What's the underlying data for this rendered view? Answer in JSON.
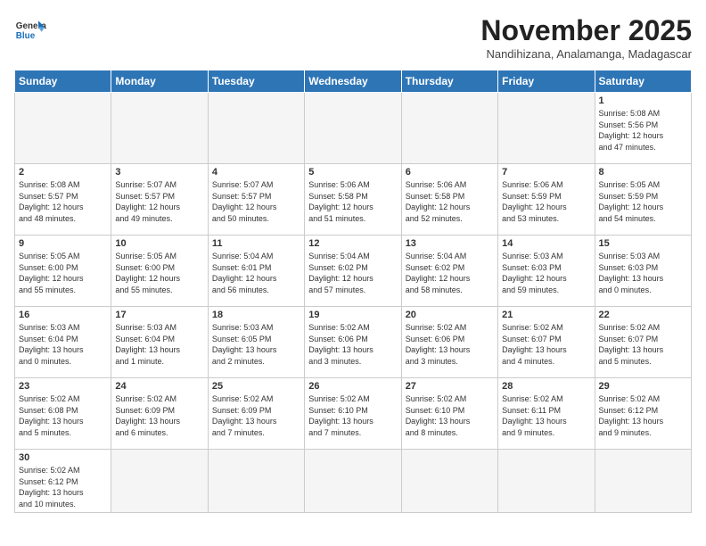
{
  "header": {
    "logo_general": "General",
    "logo_blue": "Blue",
    "month_title": "November 2025",
    "subtitle": "Nandihizana, Analamanga, Madagascar"
  },
  "weekdays": [
    "Sunday",
    "Monday",
    "Tuesday",
    "Wednesday",
    "Thursday",
    "Friday",
    "Saturday"
  ],
  "weeks": [
    [
      {
        "day": "",
        "info": ""
      },
      {
        "day": "",
        "info": ""
      },
      {
        "day": "",
        "info": ""
      },
      {
        "day": "",
        "info": ""
      },
      {
        "day": "",
        "info": ""
      },
      {
        "day": "",
        "info": ""
      },
      {
        "day": "1",
        "info": "Sunrise: 5:08 AM\nSunset: 5:56 PM\nDaylight: 12 hours\nand 47 minutes."
      }
    ],
    [
      {
        "day": "2",
        "info": "Sunrise: 5:08 AM\nSunset: 5:57 PM\nDaylight: 12 hours\nand 48 minutes."
      },
      {
        "day": "3",
        "info": "Sunrise: 5:07 AM\nSunset: 5:57 PM\nDaylight: 12 hours\nand 49 minutes."
      },
      {
        "day": "4",
        "info": "Sunrise: 5:07 AM\nSunset: 5:57 PM\nDaylight: 12 hours\nand 50 minutes."
      },
      {
        "day": "5",
        "info": "Sunrise: 5:06 AM\nSunset: 5:58 PM\nDaylight: 12 hours\nand 51 minutes."
      },
      {
        "day": "6",
        "info": "Sunrise: 5:06 AM\nSunset: 5:58 PM\nDaylight: 12 hours\nand 52 minutes."
      },
      {
        "day": "7",
        "info": "Sunrise: 5:06 AM\nSunset: 5:59 PM\nDaylight: 12 hours\nand 53 minutes."
      },
      {
        "day": "8",
        "info": "Sunrise: 5:05 AM\nSunset: 5:59 PM\nDaylight: 12 hours\nand 54 minutes."
      }
    ],
    [
      {
        "day": "9",
        "info": "Sunrise: 5:05 AM\nSunset: 6:00 PM\nDaylight: 12 hours\nand 55 minutes."
      },
      {
        "day": "10",
        "info": "Sunrise: 5:05 AM\nSunset: 6:00 PM\nDaylight: 12 hours\nand 55 minutes."
      },
      {
        "day": "11",
        "info": "Sunrise: 5:04 AM\nSunset: 6:01 PM\nDaylight: 12 hours\nand 56 minutes."
      },
      {
        "day": "12",
        "info": "Sunrise: 5:04 AM\nSunset: 6:02 PM\nDaylight: 12 hours\nand 57 minutes."
      },
      {
        "day": "13",
        "info": "Sunrise: 5:04 AM\nSunset: 6:02 PM\nDaylight: 12 hours\nand 58 minutes."
      },
      {
        "day": "14",
        "info": "Sunrise: 5:03 AM\nSunset: 6:03 PM\nDaylight: 12 hours\nand 59 minutes."
      },
      {
        "day": "15",
        "info": "Sunrise: 5:03 AM\nSunset: 6:03 PM\nDaylight: 13 hours\nand 0 minutes."
      }
    ],
    [
      {
        "day": "16",
        "info": "Sunrise: 5:03 AM\nSunset: 6:04 PM\nDaylight: 13 hours\nand 0 minutes."
      },
      {
        "day": "17",
        "info": "Sunrise: 5:03 AM\nSunset: 6:04 PM\nDaylight: 13 hours\nand 1 minute."
      },
      {
        "day": "18",
        "info": "Sunrise: 5:03 AM\nSunset: 6:05 PM\nDaylight: 13 hours\nand 2 minutes."
      },
      {
        "day": "19",
        "info": "Sunrise: 5:02 AM\nSunset: 6:06 PM\nDaylight: 13 hours\nand 3 minutes."
      },
      {
        "day": "20",
        "info": "Sunrise: 5:02 AM\nSunset: 6:06 PM\nDaylight: 13 hours\nand 3 minutes."
      },
      {
        "day": "21",
        "info": "Sunrise: 5:02 AM\nSunset: 6:07 PM\nDaylight: 13 hours\nand 4 minutes."
      },
      {
        "day": "22",
        "info": "Sunrise: 5:02 AM\nSunset: 6:07 PM\nDaylight: 13 hours\nand 5 minutes."
      }
    ],
    [
      {
        "day": "23",
        "info": "Sunrise: 5:02 AM\nSunset: 6:08 PM\nDaylight: 13 hours\nand 5 minutes."
      },
      {
        "day": "24",
        "info": "Sunrise: 5:02 AM\nSunset: 6:09 PM\nDaylight: 13 hours\nand 6 minutes."
      },
      {
        "day": "25",
        "info": "Sunrise: 5:02 AM\nSunset: 6:09 PM\nDaylight: 13 hours\nand 7 minutes."
      },
      {
        "day": "26",
        "info": "Sunrise: 5:02 AM\nSunset: 6:10 PM\nDaylight: 13 hours\nand 7 minutes."
      },
      {
        "day": "27",
        "info": "Sunrise: 5:02 AM\nSunset: 6:10 PM\nDaylight: 13 hours\nand 8 minutes."
      },
      {
        "day": "28",
        "info": "Sunrise: 5:02 AM\nSunset: 6:11 PM\nDaylight: 13 hours\nand 9 minutes."
      },
      {
        "day": "29",
        "info": "Sunrise: 5:02 AM\nSunset: 6:12 PM\nDaylight: 13 hours\nand 9 minutes."
      }
    ],
    [
      {
        "day": "30",
        "info": "Sunrise: 5:02 AM\nSunset: 6:12 PM\nDaylight: 13 hours\nand 10 minutes."
      },
      {
        "day": "",
        "info": ""
      },
      {
        "day": "",
        "info": ""
      },
      {
        "day": "",
        "info": ""
      },
      {
        "day": "",
        "info": ""
      },
      {
        "day": "",
        "info": ""
      },
      {
        "day": "",
        "info": ""
      }
    ]
  ]
}
